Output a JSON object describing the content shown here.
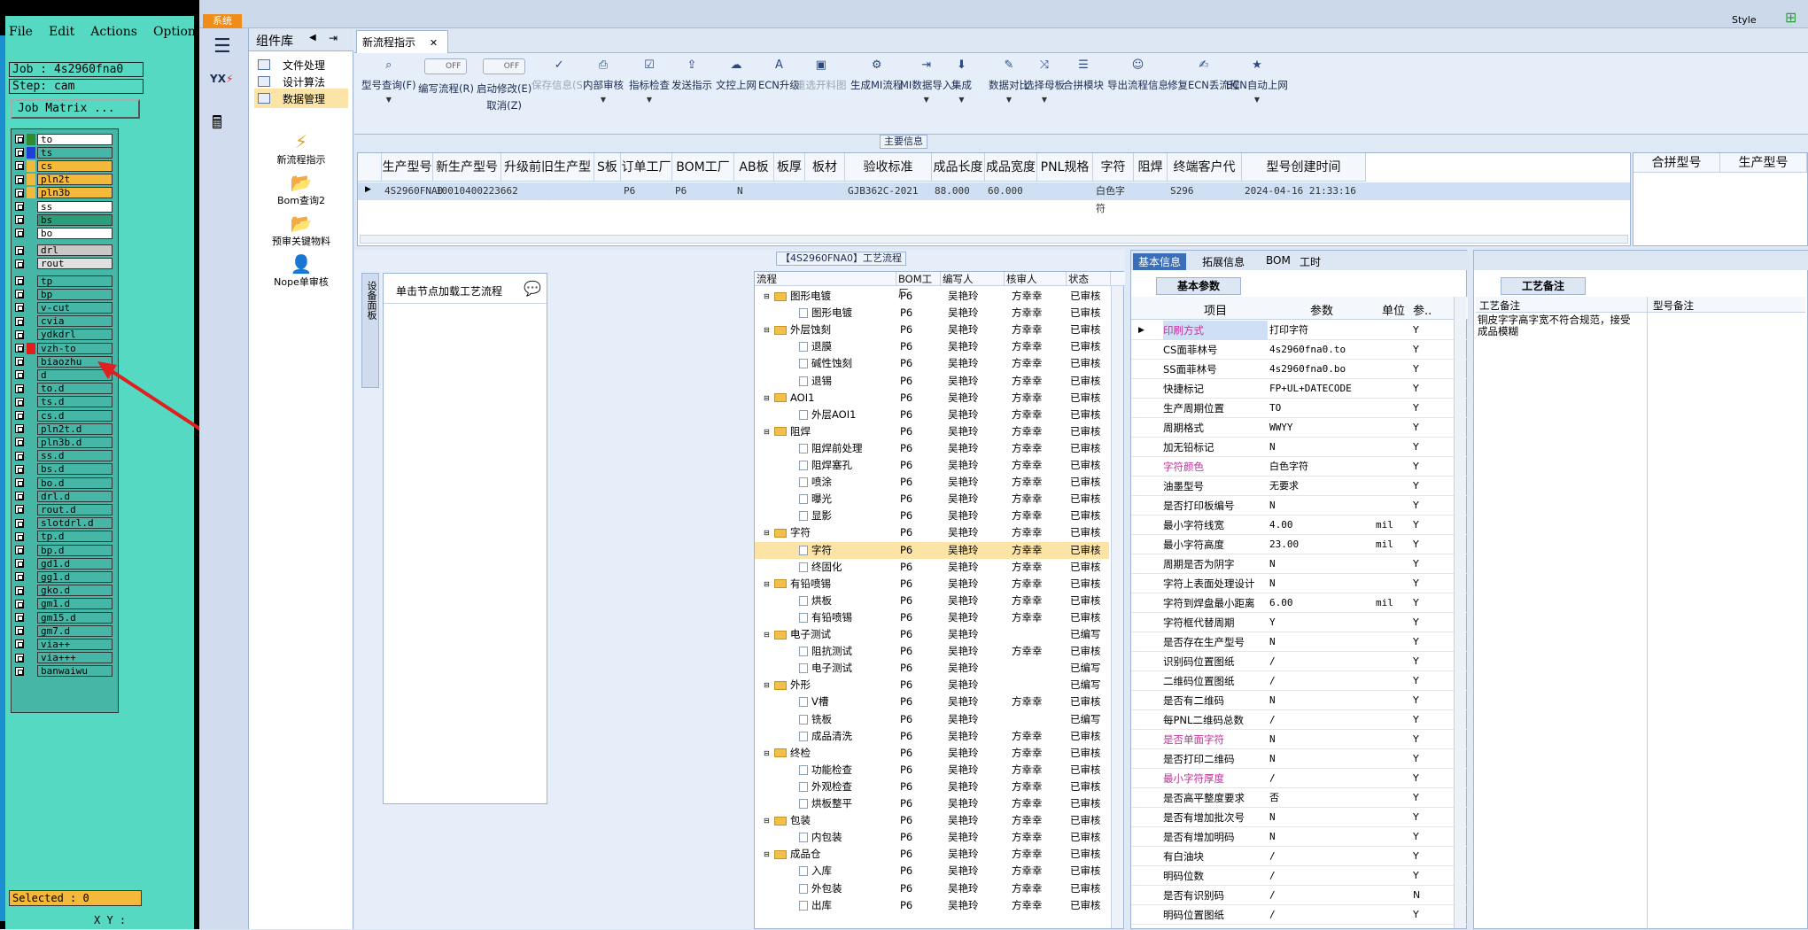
{
  "left_tool": {
    "menu": [
      "File",
      "Edit",
      "Actions",
      "Options"
    ],
    "job": "Job : 4s2960fna0",
    "step": "Step: cam",
    "matrix_btn": "Job Matrix ...",
    "selected": "Selected : 0",
    "xy": "X Y :",
    "layers": [
      {
        "name": "to",
        "color": "#2e8b2e",
        "bg": "#ffffff"
      },
      {
        "name": "ts",
        "color": "#1f3fd6",
        "bg": "#46b7a7"
      },
      {
        "name": "cs",
        "color": "#f4b83a",
        "bg": "#f4b83a"
      },
      {
        "name": "pln2t",
        "color": "#f4b83a",
        "bg": "#f4b83a"
      },
      {
        "name": "pln3b",
        "color": "#f4b83a",
        "bg": "#f4b83a"
      },
      {
        "name": "ss",
        "color": "#46b7a7",
        "bg": "#ffffff"
      },
      {
        "name": "bs",
        "color": "#46b7a7",
        "bg": "#2aa07a"
      },
      {
        "name": "bo",
        "color": "#46b7a7",
        "bg": "#ffffff"
      },
      {
        "name": "drl",
        "color": "#46b7a7",
        "bg": "#c8c8c8"
      },
      {
        "name": "rout",
        "color": "#46b7a7",
        "bg": "#e0e0e0"
      },
      {
        "name": "tp",
        "color": "#46b7a7",
        "bg": "#46b7a7"
      },
      {
        "name": "bp",
        "color": "#46b7a7",
        "bg": "#46b7a7"
      },
      {
        "name": "v-cut",
        "color": "#46b7a7",
        "bg": "#46b7a7"
      },
      {
        "name": "cvia",
        "color": "#46b7a7",
        "bg": "#46b7a7"
      },
      {
        "name": "ydkdrl",
        "color": "#46b7a7",
        "bg": "#46b7a7"
      },
      {
        "name": "vzh-to",
        "color": "#e31b1b",
        "bg": "#46b7a7"
      },
      {
        "name": "biaozhu",
        "color": "#46b7a7",
        "bg": "#46b7a7"
      },
      {
        "name": "d",
        "color": "#46b7a7",
        "bg": "#46b7a7"
      },
      {
        "name": "to.d",
        "color": "#46b7a7",
        "bg": "#46b7a7"
      },
      {
        "name": "ts.d",
        "color": "#46b7a7",
        "bg": "#46b7a7"
      },
      {
        "name": "cs.d",
        "color": "#46b7a7",
        "bg": "#46b7a7"
      },
      {
        "name": "pln2t.d",
        "color": "#46b7a7",
        "bg": "#46b7a7"
      },
      {
        "name": "pln3b.d",
        "color": "#46b7a7",
        "bg": "#46b7a7"
      },
      {
        "name": "ss.d",
        "color": "#46b7a7",
        "bg": "#46b7a7"
      },
      {
        "name": "bs.d",
        "color": "#46b7a7",
        "bg": "#46b7a7"
      },
      {
        "name": "bo.d",
        "color": "#46b7a7",
        "bg": "#46b7a7"
      },
      {
        "name": "drl.d",
        "color": "#46b7a7",
        "bg": "#46b7a7"
      },
      {
        "name": "rout.d",
        "color": "#46b7a7",
        "bg": "#46b7a7"
      },
      {
        "name": "slotdrl.d",
        "color": "#46b7a7",
        "bg": "#46b7a7"
      },
      {
        "name": "tp.d",
        "color": "#46b7a7",
        "bg": "#46b7a7"
      },
      {
        "name": "bp.d",
        "color": "#46b7a7",
        "bg": "#46b7a7"
      },
      {
        "name": "gd1.d",
        "color": "#46b7a7",
        "bg": "#46b7a7"
      },
      {
        "name": "gg1.d",
        "color": "#46b7a7",
        "bg": "#46b7a7"
      },
      {
        "name": "gko.d",
        "color": "#46b7a7",
        "bg": "#46b7a7"
      },
      {
        "name": "gm1.d",
        "color": "#46b7a7",
        "bg": "#46b7a7"
      },
      {
        "name": "gm15.d",
        "color": "#46b7a7",
        "bg": "#46b7a7"
      },
      {
        "name": "gm7.d",
        "color": "#46b7a7",
        "bg": "#46b7a7"
      },
      {
        "name": "via++",
        "color": "#46b7a7",
        "bg": "#46b7a7"
      },
      {
        "name": "via+++",
        "color": "#46b7a7",
        "bg": "#46b7a7"
      },
      {
        "name": "banwaiwu",
        "color": "#46b7a7",
        "bg": "#46b7a7"
      }
    ]
  },
  "app": {
    "sys_tab": "系统",
    "style_label": "Style",
    "component_title": "组件库",
    "nav": [
      "文件处理",
      "设计算法",
      "数据管理"
    ],
    "nav_big": [
      "新流程指示",
      "Bom查询2",
      "预审关键物料",
      "Nope单审核"
    ],
    "doc_tab": "新流程指示",
    "ribbon": [
      {
        "label": "型号查询(F)",
        "icon": "⌕",
        "dis": false,
        "dd": true
      },
      {
        "label": "编写流程(R)",
        "icon": "OFF",
        "dis": false,
        "dd": false,
        "toggle": true
      },
      {
        "label": "启动修改(E)",
        "label2": "取消(Z)",
        "icon": "OFF",
        "dis": false,
        "dd": false,
        "toggle": true
      },
      {
        "label": "保存信息(S)",
        "icon": "✓",
        "dis": true,
        "dd": false
      },
      {
        "label": "内部审核",
        "icon": "⎙",
        "dis": false,
        "dd": true
      },
      {
        "label": "指标检查",
        "icon": "☑",
        "dis": false,
        "dd": true
      },
      {
        "label": "发送指示",
        "icon": "⇪",
        "dis": false,
        "dd": false
      },
      {
        "label": "文控上网",
        "icon": "☁",
        "dis": false,
        "dd": false
      },
      {
        "label": "ECN升级",
        "icon": "A",
        "dis": false,
        "dd": false
      },
      {
        "label": "重选开料图",
        "icon": "▣",
        "dis": true,
        "dd": false
      },
      {
        "label": "生成MI流程",
        "icon": "⚙",
        "dis": false,
        "dd": false
      },
      {
        "label": "MI数据导入",
        "icon": "⇥",
        "dis": false,
        "dd": true
      },
      {
        "label": "集成",
        "icon": "⬇",
        "dis": false,
        "dd": true
      },
      {
        "label": "数据对比",
        "icon": "✎",
        "dis": false,
        "dd": true
      },
      {
        "label": "选择母板",
        "icon": "⤨",
        "dis": false,
        "dd": true
      },
      {
        "label": "合拼模块",
        "icon": "☰",
        "dis": false,
        "dd": false
      },
      {
        "label": "导出流程信息",
        "icon": "☺",
        "dis": false,
        "dd": false
      },
      {
        "label": "修复ECN丢流程",
        "icon": "✍",
        "dis": false,
        "dd": false
      },
      {
        "label": "ECN自动上网",
        "icon": "★",
        "dis": false,
        "dd": true
      }
    ],
    "main_info_tag": "主要信息",
    "grid_headers": [
      "生产型号",
      "新生产型号",
      "升级前旧生产型号",
      "S板",
      "订单工厂",
      "BOM工厂",
      "AB板",
      "板厚",
      "板材",
      "验收标准",
      "成品长度",
      "成品宽度",
      "PNL规格",
      "字符",
      "阻焊",
      "终端客户代码",
      "型号创建时间"
    ],
    "grid_row": [
      "4S2960FNA0",
      "10010400223662",
      "",
      "",
      "P6",
      "P6",
      "N",
      "",
      "",
      "GJB362C-2021",
      "88.000",
      "60.000",
      "",
      "白色字符",
      "",
      "S296",
      "2024-04-16 21:33:16"
    ],
    "grid2_headers": [
      "合拼型号",
      "生产型号"
    ],
    "proc_tag": "【4S2960FNA0】工艺流程",
    "side_vert": "设备面板",
    "load_hint": "单击节点加载工艺流程",
    "tree_headers": [
      "流程",
      "BOM工厂",
      "编写人",
      "核审人",
      "状态"
    ],
    "tree": [
      {
        "name": "图形电镀",
        "lvl": 0,
        "bom": "P6",
        "w": "吴艳玲",
        "r": "方幸幸",
        "s": "已审核"
      },
      {
        "name": "图形电镀",
        "lvl": 1,
        "bom": "P6",
        "w": "吴艳玲",
        "r": "方幸幸",
        "s": "已审核"
      },
      {
        "name": "外层蚀刻",
        "lvl": 0,
        "bom": "P6",
        "w": "吴艳玲",
        "r": "方幸幸",
        "s": "已审核"
      },
      {
        "name": "退膜",
        "lvl": 1,
        "bom": "P6",
        "w": "吴艳玲",
        "r": "方幸幸",
        "s": "已审核"
      },
      {
        "name": "碱性蚀刻",
        "lvl": 1,
        "bom": "P6",
        "w": "吴艳玲",
        "r": "方幸幸",
        "s": "已审核"
      },
      {
        "name": "退锡",
        "lvl": 1,
        "bom": "P6",
        "w": "吴艳玲",
        "r": "方幸幸",
        "s": "已审核"
      },
      {
        "name": "AOI1",
        "lvl": 0,
        "bom": "P6",
        "w": "吴艳玲",
        "r": "方幸幸",
        "s": "已审核"
      },
      {
        "name": "外层AOI1",
        "lvl": 1,
        "bom": "P6",
        "w": "吴艳玲",
        "r": "方幸幸",
        "s": "已审核"
      },
      {
        "name": "阻焊",
        "lvl": 0,
        "bom": "P6",
        "w": "吴艳玲",
        "r": "方幸幸",
        "s": "已审核"
      },
      {
        "name": "阻焊前处理",
        "lvl": 1,
        "bom": "P6",
        "w": "吴艳玲",
        "r": "方幸幸",
        "s": "已审核"
      },
      {
        "name": "阻焊塞孔",
        "lvl": 1,
        "bom": "P6",
        "w": "吴艳玲",
        "r": "方幸幸",
        "s": "已审核"
      },
      {
        "name": "喷涂",
        "lvl": 1,
        "bom": "P6",
        "w": "吴艳玲",
        "r": "方幸幸",
        "s": "已审核"
      },
      {
        "name": "曝光",
        "lvl": 1,
        "bom": "P6",
        "w": "吴艳玲",
        "r": "方幸幸",
        "s": "已审核"
      },
      {
        "name": "显影",
        "lvl": 1,
        "bom": "P6",
        "w": "吴艳玲",
        "r": "方幸幸",
        "s": "已审核"
      },
      {
        "name": "字符",
        "lvl": 0,
        "bom": "P6",
        "w": "吴艳玲",
        "r": "方幸幸",
        "s": "已审核"
      },
      {
        "name": "字符",
        "lvl": 1,
        "bom": "P6",
        "w": "吴艳玲",
        "r": "方幸幸",
        "s": "已审核",
        "sel": true
      },
      {
        "name": "终固化",
        "lvl": 1,
        "bom": "P6",
        "w": "吴艳玲",
        "r": "方幸幸",
        "s": "已审核"
      },
      {
        "name": "有铅喷锡",
        "lvl": 0,
        "bom": "P6",
        "w": "吴艳玲",
        "r": "方幸幸",
        "s": "已审核"
      },
      {
        "name": "烘板",
        "lvl": 1,
        "bom": "P6",
        "w": "吴艳玲",
        "r": "方幸幸",
        "s": "已审核"
      },
      {
        "name": "有铅喷锡",
        "lvl": 1,
        "bom": "P6",
        "w": "吴艳玲",
        "r": "方幸幸",
        "s": "已审核"
      },
      {
        "name": "电子测试",
        "lvl": 0,
        "bom": "P6",
        "w": "吴艳玲",
        "r": "",
        "s": "已编写"
      },
      {
        "name": "阻抗测试",
        "lvl": 1,
        "bom": "P6",
        "w": "吴艳玲",
        "r": "方幸幸",
        "s": "已审核"
      },
      {
        "name": "电子测试",
        "lvl": 1,
        "bom": "P6",
        "w": "吴艳玲",
        "r": "",
        "s": "已编写"
      },
      {
        "name": "外形",
        "lvl": 0,
        "bom": "P6",
        "w": "吴艳玲",
        "r": "",
        "s": "已编写"
      },
      {
        "name": "V槽",
        "lvl": 1,
        "bom": "P6",
        "w": "吴艳玲",
        "r": "方幸幸",
        "s": "已审核"
      },
      {
        "name": "铣板",
        "lvl": 1,
        "bom": "P6",
        "w": "吴艳玲",
        "r": "",
        "s": "已编写"
      },
      {
        "name": "成品清洗",
        "lvl": 1,
        "bom": "P6",
        "w": "吴艳玲",
        "r": "方幸幸",
        "s": "已审核"
      },
      {
        "name": "终检",
        "lvl": 0,
        "bom": "P6",
        "w": "吴艳玲",
        "r": "方幸幸",
        "s": "已审核"
      },
      {
        "name": "功能检查",
        "lvl": 1,
        "bom": "P6",
        "w": "吴艳玲",
        "r": "方幸幸",
        "s": "已审核"
      },
      {
        "name": "外观检查",
        "lvl": 1,
        "bom": "P6",
        "w": "吴艳玲",
        "r": "方幸幸",
        "s": "已审核"
      },
      {
        "name": "烘板整平",
        "lvl": 1,
        "bom": "P6",
        "w": "吴艳玲",
        "r": "方幸幸",
        "s": "已审核"
      },
      {
        "name": "包装",
        "lvl": 0,
        "bom": "P6",
        "w": "吴艳玲",
        "r": "方幸幸",
        "s": "已审核"
      },
      {
        "name": "内包装",
        "lvl": 1,
        "bom": "P6",
        "w": "吴艳玲",
        "r": "方幸幸",
        "s": "已审核"
      },
      {
        "name": "成品仓",
        "lvl": 0,
        "bom": "P6",
        "w": "吴艳玲",
        "r": "方幸幸",
        "s": "已审核"
      },
      {
        "name": "入库",
        "lvl": 1,
        "bom": "P6",
        "w": "吴艳玲",
        "r": "方幸幸",
        "s": "已审核"
      },
      {
        "name": "外包装",
        "lvl": 1,
        "bom": "P6",
        "w": "吴艳玲",
        "r": "方幸幸",
        "s": "已审核"
      },
      {
        "name": "出库",
        "lvl": 1,
        "bom": "P6",
        "w": "吴艳玲",
        "r": "方幸幸",
        "s": "已审核"
      }
    ],
    "param_tabs": [
      "基本信息",
      "拓展信息",
      "BOM",
      "工时"
    ],
    "basic_tag": "基本参数",
    "param_headers": [
      "项目",
      "参数",
      "单位",
      "参..."
    ],
    "params": [
      {
        "k": "印刷方式",
        "v": "打印字符",
        "u": "",
        "y": "Y",
        "hl": true
      },
      {
        "k": "CS面菲林号",
        "v": "4s2960fna0.to",
        "u": "",
        "y": "Y"
      },
      {
        "k": "SS面菲林号",
        "v": "4s2960fna0.bo",
        "u": "",
        "y": "Y"
      },
      {
        "k": "快捷标记",
        "v": "FP+UL+DATECODE",
        "u": "",
        "y": "Y"
      },
      {
        "k": "生产周期位置",
        "v": "TO",
        "u": "",
        "y": "Y"
      },
      {
        "k": "周期格式",
        "v": "WWYY",
        "u": "",
        "y": "Y"
      },
      {
        "k": "加无铅标记",
        "v": "N",
        "u": "",
        "y": "Y"
      },
      {
        "k": "字符颜色",
        "v": "白色字符",
        "u": "",
        "y": "Y",
        "hl": true
      },
      {
        "k": "油墨型号",
        "v": "无要求",
        "u": "",
        "y": "Y"
      },
      {
        "k": "是否打印板编号",
        "v": "N",
        "u": "",
        "y": "Y"
      },
      {
        "k": "最小字符线宽",
        "v": "4.00",
        "u": "mil",
        "y": "Y"
      },
      {
        "k": "最小字符高度",
        "v": "23.00",
        "u": "mil",
        "y": "Y"
      },
      {
        "k": "周期是否为阴字",
        "v": "N",
        "u": "",
        "y": "Y"
      },
      {
        "k": "字符上表面处理设计",
        "v": "N",
        "u": "",
        "y": "Y"
      },
      {
        "k": "字符到焊盘最小距离",
        "v": "6.00",
        "u": "mil",
        "y": "Y"
      },
      {
        "k": "字符框代替周期",
        "v": "Y",
        "u": "",
        "y": "Y"
      },
      {
        "k": "是否存在生产型号",
        "v": "N",
        "u": "",
        "y": "Y"
      },
      {
        "k": "识别码位置图纸",
        "v": "/",
        "u": "",
        "y": "Y"
      },
      {
        "k": "二维码位置图纸",
        "v": "/",
        "u": "",
        "y": "Y"
      },
      {
        "k": "是否有二维码",
        "v": "N",
        "u": "",
        "y": "Y"
      },
      {
        "k": "每PNL二维码总数",
        "v": "/",
        "u": "",
        "y": "Y"
      },
      {
        "k": "是否单面字符",
        "v": "N",
        "u": "",
        "y": "Y",
        "hl": true
      },
      {
        "k": "是否打印二维码",
        "v": "N",
        "u": "",
        "y": "Y"
      },
      {
        "k": "最小字符厚度",
        "v": "/",
        "u": "",
        "y": "Y",
        "hl": true
      },
      {
        "k": "是否高平整度要求",
        "v": "否",
        "u": "",
        "y": "Y"
      },
      {
        "k": "是否有增加批次号",
        "v": "N",
        "u": "",
        "y": "Y"
      },
      {
        "k": "是否有增加明码",
        "v": "N",
        "u": "",
        "y": "Y"
      },
      {
        "k": "有白油块",
        "v": "/",
        "u": "",
        "y": "Y"
      },
      {
        "k": "明码位数",
        "v": "/",
        "u": "",
        "y": "Y"
      },
      {
        "k": "是否有识别码",
        "v": "/",
        "u": "",
        "y": "N"
      },
      {
        "k": "明码位置图纸",
        "v": "/",
        "u": "",
        "y": "Y"
      }
    ],
    "remark_tag": "工艺备注",
    "remark_headers": [
      "工艺备注",
      "型号备注"
    ],
    "remark_text": "铜皮字字高字宽不符合规范，接受成品模糊"
  }
}
